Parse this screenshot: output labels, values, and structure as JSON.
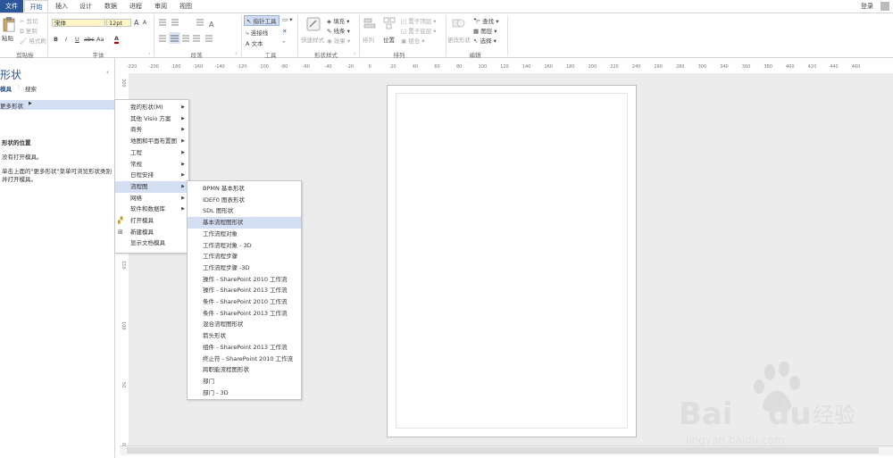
{
  "tabs": [
    "文件",
    "开始",
    "插入",
    "设计",
    "数据",
    "进程",
    "审阅",
    "视图"
  ],
  "login": "登录",
  "ribbon": {
    "clipboard": {
      "paste": "粘贴",
      "cut": "剪切",
      "copy": "复制",
      "format_painter": "格式刷",
      "label": "剪贴板"
    },
    "font": {
      "family": "宋体",
      "size": "12pt",
      "bold": "B",
      "italic": "I",
      "underline": "U",
      "strike": "abc",
      "case": "Aa",
      "color": "A",
      "label": "字体",
      "grow": "A",
      "shrink": "A"
    },
    "paragraph": {
      "label": "段落"
    },
    "tools": {
      "pointer": "指针工具",
      "connector": "连接线",
      "text": "文本",
      "label": "工具"
    },
    "shape_styles": {
      "quick_styles": "快速样式",
      "fill": "填充",
      "line": "线条",
      "effects": "效果",
      "label": "形状样式"
    },
    "arrange": {
      "align": "排列",
      "position": "位置",
      "bring_front": "置于顶层",
      "send_back": "置于底层",
      "group": "组合",
      "label": "排列"
    },
    "editing": {
      "change_shape": "更改形状",
      "find": "查找",
      "layers": "图层",
      "select": "选择",
      "label": "编辑"
    }
  },
  "left_pane": {
    "title": "形状",
    "tab_stencils": "模具",
    "tab_search": "搜索",
    "more_shapes": "更多形状",
    "section_title": "形状的位置",
    "no_open": "没有打开模具。",
    "hint_line1": "单击上面的\"更多形状\"菜单可浏览形状类别",
    "hint_line2": "并打开模具。"
  },
  "menu1": [
    {
      "label": "我的形状(M)",
      "arrow": true
    },
    {
      "label": "其他 Visio 方案",
      "arrow": true
    },
    {
      "label": "商务",
      "arrow": true
    },
    {
      "label": "地图和平面布置图",
      "arrow": true
    },
    {
      "label": "工程",
      "arrow": true
    },
    {
      "label": "常规",
      "arrow": true
    },
    {
      "label": "日程安排",
      "arrow": true
    },
    {
      "label": "流程图",
      "arrow": true,
      "highlight": true
    },
    {
      "label": "网络",
      "arrow": true
    },
    {
      "label": "软件和数据库",
      "arrow": true
    },
    {
      "label": "打开模具",
      "arrow": false,
      "icon": "open"
    },
    {
      "label": "新建模具",
      "arrow": false,
      "icon": "new"
    },
    {
      "label": "显示文档模具",
      "arrow": false
    }
  ],
  "menu2": [
    {
      "label": "BPMN 基本形状"
    },
    {
      "label": "IDEF0 图表形状"
    },
    {
      "label": "SDL 图形状"
    },
    {
      "label": "基本流程图形状",
      "highlight": true
    },
    {
      "label": "工作流程对象"
    },
    {
      "label": "工作流程对象 - 3D"
    },
    {
      "label": "工作流程步骤"
    },
    {
      "label": "工作流程步骤 -3D"
    },
    {
      "label": "操作 - SharePoint 2010 工作流"
    },
    {
      "label": "操作 - SharePoint 2013 工作流"
    },
    {
      "label": "条件 - SharePoint 2010 工作流"
    },
    {
      "label": "条件 - SharePoint 2013 工作流"
    },
    {
      "label": "混合流程图形状"
    },
    {
      "label": "箭头形状"
    },
    {
      "label": "组件 - SharePoint 2013 工作流"
    },
    {
      "label": "终止符 - SharePoint 2010 工作流"
    },
    {
      "label": "跨职能流程图形状"
    },
    {
      "label": "部门"
    },
    {
      "label": "部门 - 3D"
    }
  ],
  "hruler_ticks": [
    "-220",
    "-200",
    "-180",
    "-160",
    "-140",
    "-120",
    "-100",
    "-80",
    "-60",
    "-40",
    "-20",
    "0",
    "20",
    "40",
    "60",
    "80",
    "100",
    "120",
    "140",
    "160",
    "180",
    "200",
    "220",
    "240",
    "260",
    "280",
    "300",
    "340",
    "360",
    "380",
    "400",
    "420",
    "440",
    "460"
  ],
  "vruler_ticks": [
    "300",
    "250",
    "200",
    "150",
    "100",
    "50",
    "0"
  ],
  "watermark": {
    "brand": "Bai",
    "brand2": "du",
    "cn": "经验",
    "url": "jingyan.baidu.com"
  },
  "colors": {
    "file_tab": "#2b579a",
    "accent": "#2b579a",
    "highlight": "#d5dff3"
  }
}
